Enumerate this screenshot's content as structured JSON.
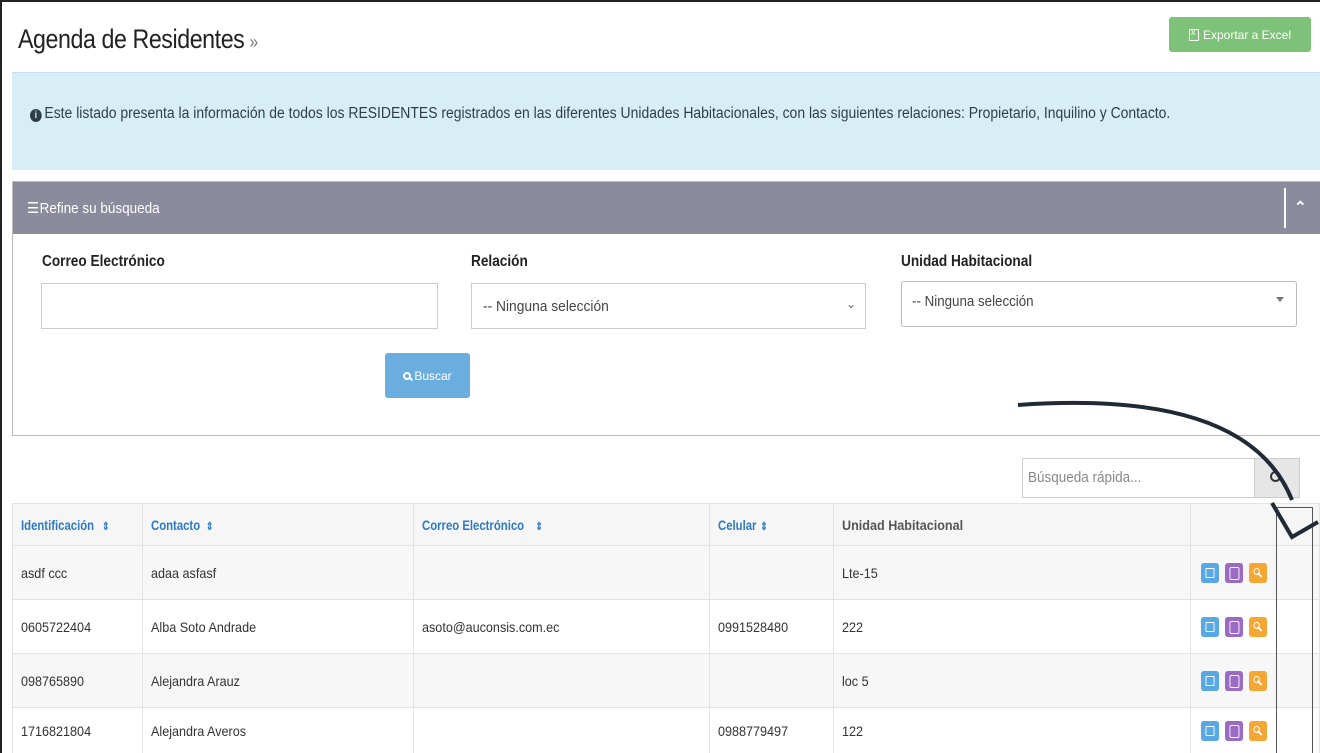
{
  "header": {
    "title": "Agenda de Residentes",
    "title_suffix": "»",
    "export_label": "Exportar a Excel"
  },
  "info": {
    "icon": "info-circle-icon",
    "text": "Este listado presenta la información de todos los RESIDENTES registrados en las diferentes Unidades Habitacionales, con las siguientes relaciones: Propietario, Inquilino y Contacto."
  },
  "filter": {
    "title": "Refine su búsqueda",
    "email_label": "Correo Electrónico",
    "email_value": "",
    "relation_label": "Relación",
    "relation_selected": "-- Ninguna selección",
    "unit_label": "Unidad Habitacional",
    "unit_selected": "-- Ninguna selección",
    "search_button": "Buscar"
  },
  "quick_search": {
    "placeholder": "Búsqueda rápida..."
  },
  "table": {
    "columns": [
      "Identificación",
      "Contacto",
      "Correo Electrónico",
      "Celular",
      "Unidad Habitacional"
    ],
    "rows": [
      {
        "id": "asdf ccc",
        "contact": "adaa asfasf",
        "email": "",
        "phone": "",
        "unit": "Lte-15"
      },
      {
        "id": "0605722404",
        "contact": "Alba Soto Andrade",
        "email": "asoto@auconsis.com.ec",
        "phone": "0991528480",
        "unit": "222"
      },
      {
        "id": "098765890",
        "contact": "Alejandra Arauz",
        "email": "",
        "phone": "",
        "unit": "loc 5"
      },
      {
        "id": "1716821804",
        "contact": "Alejandra Averos",
        "email": "",
        "phone": "0988779497",
        "unit": "122"
      }
    ]
  },
  "colors": {
    "export": "#7dc278",
    "info_bg": "#d8eef7",
    "filter_header": "#8b8b9e",
    "search_button": "#6aaee0",
    "header_link": "#2c7ac4",
    "edit_action": "#58a9e3",
    "card_action": "#9a6ac4",
    "key_action": "#f4a733"
  }
}
